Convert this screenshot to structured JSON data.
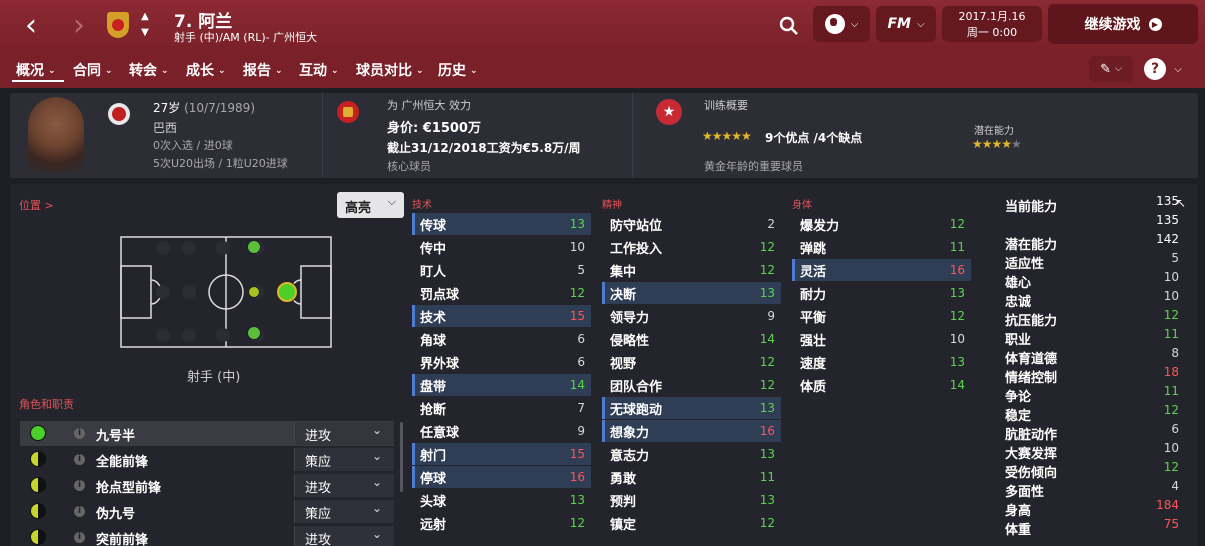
{
  "header": {
    "number_name": "7. 阿兰",
    "position_club": "射手 (中)/AM (RL)- 广州恒大",
    "date": "2017.1月.16",
    "day_time": "周一 0:00",
    "continue_label": "继续游戏",
    "fm_label": "FM"
  },
  "nav": [
    "概况",
    "合同",
    "转会",
    "成长",
    "报告",
    "互动",
    "球员对比",
    "历史"
  ],
  "info": {
    "age": "27岁",
    "dob": "(10/7/1989)",
    "nation": "巴西",
    "caps": "0次入选 / 进0球",
    "u20": "5次U20出场 / 1粒U20进球",
    "plays_for": "为 广州恒大 效力",
    "value": "身价: €1500万",
    "contract": "截止31/12/2018工资为€5.8万/周",
    "status": "核心球员",
    "training_title": "训练概要",
    "traits": "9个优点 /4个缺点",
    "potential_label": "潜在能力",
    "summary": "黄金年龄的重要球员"
  },
  "pos": {
    "title": "位置 >",
    "mode": "高亮",
    "pos_label": "射手 (中)"
  },
  "roles": {
    "title": "角色和职责",
    "items": [
      {
        "name": "九号半",
        "duty": "进攻"
      },
      {
        "name": "全能前锋",
        "duty": "策应"
      },
      {
        "name": "抢点型前锋",
        "duty": "进攻"
      },
      {
        "name": "伪九号",
        "duty": "策应"
      },
      {
        "name": "突前前锋",
        "duty": "进攻"
      }
    ]
  },
  "tech": {
    "title": "技术",
    "items": [
      {
        "n": "传球",
        "v": "13"
      },
      {
        "n": "传中",
        "v": "10"
      },
      {
        "n": "盯人",
        "v": "5"
      },
      {
        "n": "罚点球",
        "v": "12"
      },
      {
        "n": "技术",
        "v": "15"
      },
      {
        "n": "角球",
        "v": "6"
      },
      {
        "n": "界外球",
        "v": "6"
      },
      {
        "n": "盘带",
        "v": "14"
      },
      {
        "n": "抢断",
        "v": "7"
      },
      {
        "n": "任意球",
        "v": "9"
      },
      {
        "n": "射门",
        "v": "15"
      },
      {
        "n": "停球",
        "v": "16"
      },
      {
        "n": "头球",
        "v": "13"
      },
      {
        "n": "远射",
        "v": "12"
      }
    ]
  },
  "mental": {
    "title": "精神",
    "items": [
      {
        "n": "防守站位",
        "v": "2"
      },
      {
        "n": "工作投入",
        "v": "12"
      },
      {
        "n": "集中",
        "v": "12"
      },
      {
        "n": "决断",
        "v": "13"
      },
      {
        "n": "领导力",
        "v": "9"
      },
      {
        "n": "侵略性",
        "v": "14"
      },
      {
        "n": "视野",
        "v": "12"
      },
      {
        "n": "团队合作",
        "v": "12"
      },
      {
        "n": "无球跑动",
        "v": "13"
      },
      {
        "n": "想象力",
        "v": "16"
      },
      {
        "n": "意志力",
        "v": "13"
      },
      {
        "n": "勇敢",
        "v": "11"
      },
      {
        "n": "预判",
        "v": "13"
      },
      {
        "n": "镇定",
        "v": "12"
      }
    ]
  },
  "phys": {
    "title": "身体",
    "items": [
      {
        "n": "爆发力",
        "v": "12"
      },
      {
        "n": "弹跳",
        "v": "11"
      },
      {
        "n": "灵活",
        "v": "16"
      },
      {
        "n": "耐力",
        "v": "13"
      },
      {
        "n": "平衡",
        "v": "12"
      },
      {
        "n": "强壮",
        "v": "10"
      },
      {
        "n": "速度",
        "v": "13"
      },
      {
        "n": "体质",
        "v": "14"
      }
    ]
  },
  "hidden": {
    "items": [
      {
        "n": "当前能力",
        "v": "135"
      },
      {
        "n": "",
        "v": "135"
      },
      {
        "n": "潜在能力",
        "v": "142"
      },
      {
        "n": "适应性",
        "v": "5"
      },
      {
        "n": "雄心",
        "v": "10"
      },
      {
        "n": "忠诚",
        "v": "10"
      },
      {
        "n": "抗压能力",
        "v": "12"
      },
      {
        "n": "职业",
        "v": "11"
      },
      {
        "n": "体育道德",
        "v": "8"
      },
      {
        "n": "情绪控制",
        "v": "18"
      },
      {
        "n": "争论",
        "v": "11"
      },
      {
        "n": "稳定",
        "v": "12"
      },
      {
        "n": "肮脏动作",
        "v": "6"
      },
      {
        "n": "大赛发挥",
        "v": "10"
      },
      {
        "n": "受伤倾向",
        "v": "12"
      },
      {
        "n": "多面性",
        "v": "4"
      },
      {
        "n": "身高",
        "v": "184"
      },
      {
        "n": "体重",
        "v": "75"
      }
    ]
  },
  "colors": {
    "accent": "#7a2029",
    "green": "#5bd44d",
    "red": "#ff5555",
    "highlight": "#2f3d55"
  }
}
